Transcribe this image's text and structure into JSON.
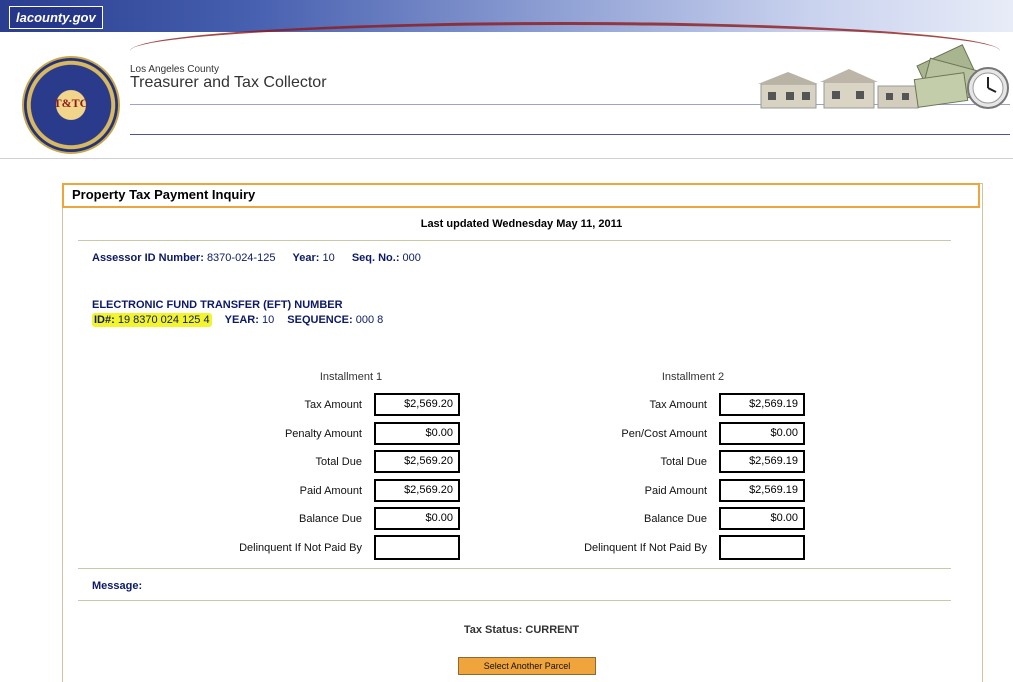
{
  "header": {
    "site_logo": "lacounty.gov",
    "seal_text": "T&TC",
    "county": "Los Angeles County",
    "agency": "Treasurer and Tax Collector"
  },
  "panel": {
    "title": "Property Tax Payment Inquiry",
    "last_updated": "Last updated Wednesday May 11, 2011"
  },
  "assessor": {
    "id_label": "Assessor ID Number:",
    "id_value": "8370-024-125",
    "year_label": "Year:",
    "year_value": "10",
    "seq_label": "Seq. No.:",
    "seq_value": "000"
  },
  "eft": {
    "title": "ELECTRONIC FUND TRANSFER (EFT) NUMBER",
    "id_label": "ID#:",
    "id_value": "19 8370 024 125 4",
    "year_label": "YEAR:",
    "year_value": "10",
    "seq_label": "SEQUENCE:",
    "seq_value": "000 8"
  },
  "installment1": {
    "title": "Installment 1",
    "rows": [
      {
        "label": "Tax Amount",
        "value": "$2,569.20"
      },
      {
        "label": "Penalty Amount",
        "value": "$0.00"
      },
      {
        "label": "Total Due",
        "value": "$2,569.20"
      },
      {
        "label": "Paid Amount",
        "value": "$2,569.20"
      },
      {
        "label": "Balance Due",
        "value": "$0.00"
      },
      {
        "label": "Delinquent If Not Paid By",
        "value": ""
      }
    ]
  },
  "installment2": {
    "title": "Installment 2",
    "rows": [
      {
        "label": "Tax Amount",
        "value": "$2,569.19"
      },
      {
        "label": "Pen/Cost Amount",
        "value": "$0.00"
      },
      {
        "label": "Total Due",
        "value": "$2,569.19"
      },
      {
        "label": "Paid Amount",
        "value": "$2,569.19"
      },
      {
        "label": "Balance Due",
        "value": "$0.00"
      },
      {
        "label": "Delinquent If Not Paid By",
        "value": ""
      }
    ]
  },
  "message_label": "Message:",
  "tax_status": "Tax Status: CURRENT",
  "select_button": "Select Another Parcel",
  "colors": {
    "accent": "#f0a43c",
    "navy": "#0c1a66",
    "highlight": "#f4f42a"
  }
}
